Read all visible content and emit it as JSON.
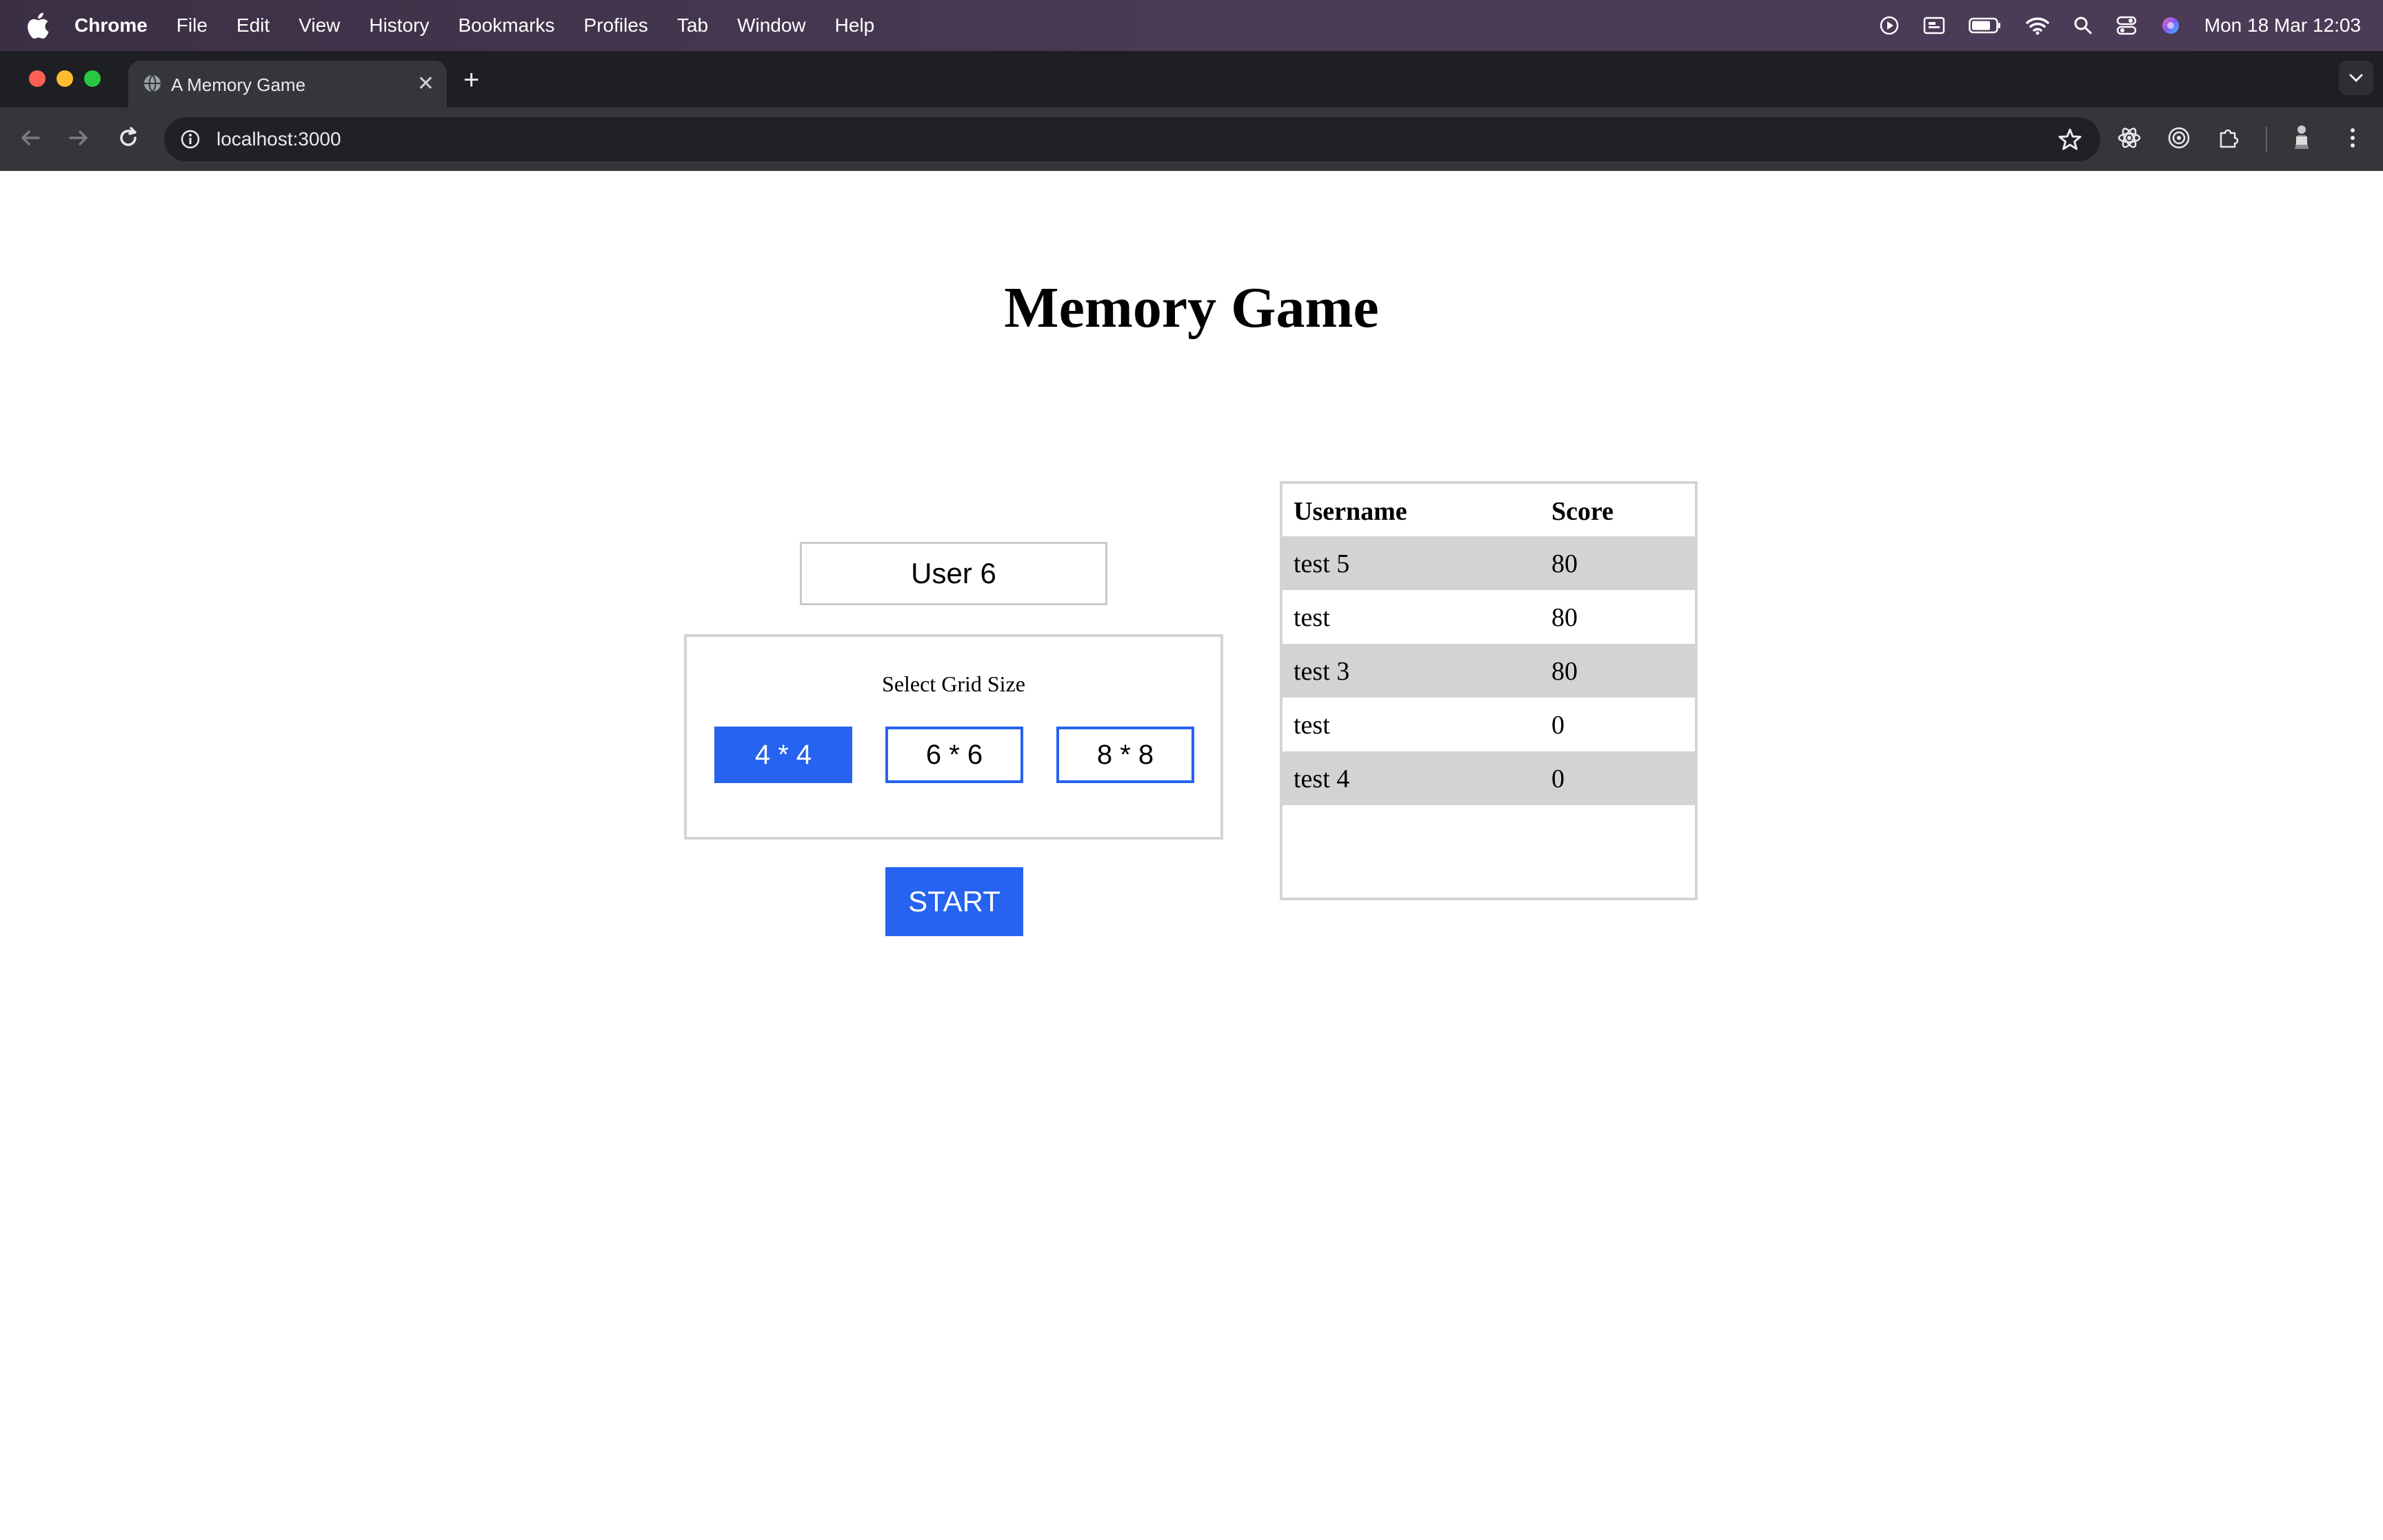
{
  "menubar": {
    "app": "Chrome",
    "items": [
      "File",
      "Edit",
      "View",
      "History",
      "Bookmarks",
      "Profiles",
      "Tab",
      "Window",
      "Help"
    ],
    "clock": "Mon 18 Mar  12:03"
  },
  "browser": {
    "tab_title": "A Memory Game",
    "url": "localhost:3000"
  },
  "game": {
    "title": "Memory Game",
    "username_value": "User 6",
    "grid_label": "Select Grid Size",
    "grid_options": [
      "4 * 4",
      "6 * 6",
      "8 * 8"
    ],
    "selected_grid": "4 * 4",
    "start_label": "START"
  },
  "leaderboard": {
    "headers": [
      "Username",
      "Score"
    ],
    "rows": [
      [
        "test 5",
        "80"
      ],
      [
        "test",
        "80"
      ],
      [
        "test 3",
        "80"
      ],
      [
        "test",
        "0"
      ],
      [
        "test 4",
        "0"
      ]
    ]
  },
  "colors": {
    "accent": "#2563f0",
    "row_shade": "#d3d3d3"
  }
}
